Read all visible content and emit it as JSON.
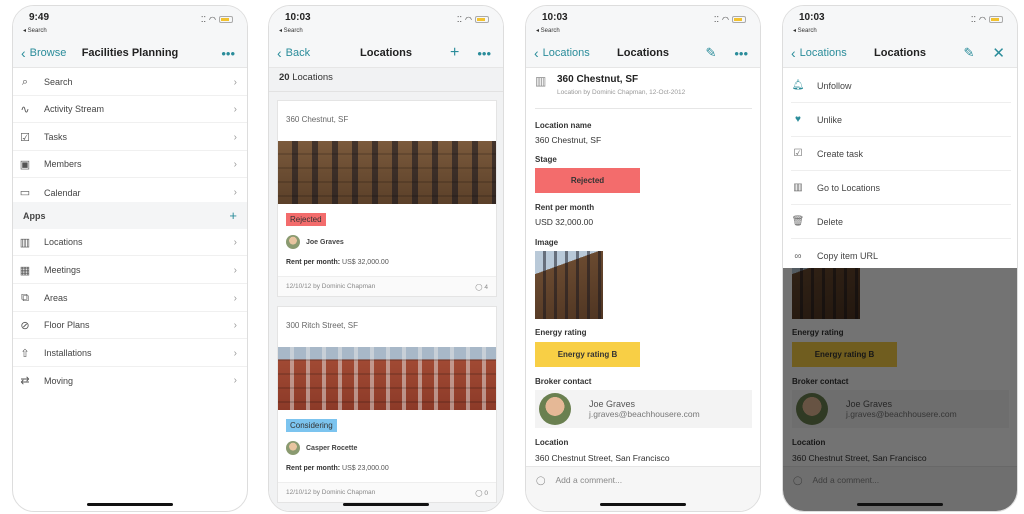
{
  "accent": "#2a8c9a",
  "status": {
    "search": "◂ Search"
  },
  "screen1": {
    "time": "9:49",
    "back": "Browse",
    "title": "Facilities Planning",
    "more": "•••",
    "items": [
      {
        "label": "Search",
        "icon": "search-icon"
      },
      {
        "label": "Activity Stream",
        "icon": "activity-icon"
      },
      {
        "label": "Tasks",
        "icon": "tasks-icon"
      },
      {
        "label": "Members",
        "icon": "members-icon"
      },
      {
        "label": "Calendar",
        "icon": "calendar-icon"
      }
    ],
    "apps_label": "Apps",
    "apps": [
      {
        "label": "Locations",
        "icon": "building-icon"
      },
      {
        "label": "Meetings",
        "icon": "meetings-icon"
      },
      {
        "label": "Areas",
        "icon": "areas-icon"
      },
      {
        "label": "Floor Plans",
        "icon": "compass-icon"
      },
      {
        "label": "Installations",
        "icon": "installations-icon"
      },
      {
        "label": "Moving",
        "icon": "moving-icon"
      }
    ]
  },
  "screen2": {
    "time": "10:03",
    "back": "Back",
    "title": "Locations",
    "count_num": "20",
    "count_label": "Locations",
    "cards": [
      {
        "title": "360 Chestnut, SF",
        "stage": "Rejected",
        "stage_color": "#f36c6c",
        "person": "Joe Graves",
        "rent_label": "Rent per month:",
        "rent": "US$ 32,000.00",
        "footer": "12/10/12 by Dominic Chapman",
        "comments": "4"
      },
      {
        "title": "300 Ritch Street, SF",
        "stage": "Considering",
        "stage_color": "#7cc4ef",
        "person": "Casper Rocette",
        "rent_label": "Rent per month:",
        "rent": "US$ 23,000.00",
        "footer": "12/10/12 by Dominic Chapman",
        "comments": "0"
      }
    ]
  },
  "screen3": {
    "time": "10:03",
    "back": "Locations",
    "title": "Locations",
    "item_title": "360 Chestnut, SF",
    "item_sub": "Location by Dominic Chapman, 12-Oct-2012",
    "location_name_label": "Location name",
    "location_name": "360 Chestnut, SF",
    "stage_label": "Stage",
    "stage": "Rejected",
    "stage_color": "#f36c6c",
    "rent_label": "Rent per month",
    "rent": "USD 32,000.00",
    "image_label": "Image",
    "energy_label": "Energy rating",
    "energy": "Energy rating B",
    "energy_color": "#f8cf45",
    "broker_label": "Broker contact",
    "broker_name": "Joe Graves",
    "broker_email": "j.graves@beachhousere.com",
    "location_label": "Location",
    "location": "360 Chestnut Street, San Francisco",
    "comment_placeholder": "Add a comment..."
  },
  "screen4": {
    "time": "10:03",
    "back": "Locations",
    "title": "Locations",
    "menu": [
      {
        "label": "Unfollow",
        "icon": "bell-icon"
      },
      {
        "label": "Unlike",
        "icon": "heart-icon"
      },
      {
        "label": "Create task",
        "icon": "task-icon"
      },
      {
        "label": "Go to Locations",
        "icon": "building-icon"
      },
      {
        "label": "Delete",
        "icon": "trash-icon"
      },
      {
        "label": "Copy item URL",
        "icon": "link-icon"
      }
    ]
  }
}
